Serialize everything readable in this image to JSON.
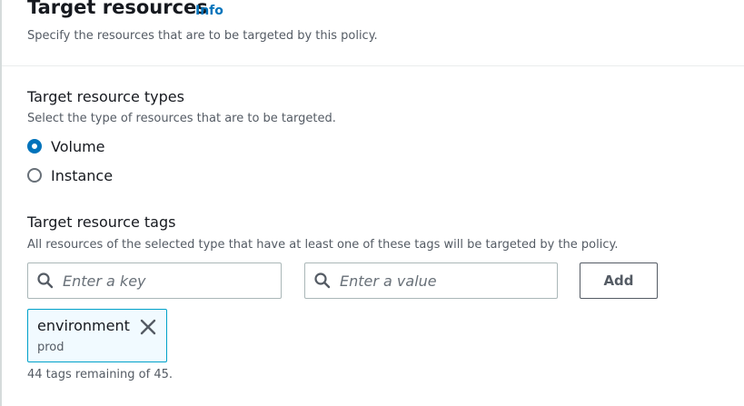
{
  "header": {
    "title": "Target resources",
    "info_link": "Info",
    "description": "Specify the resources that are to be targeted by this policy."
  },
  "resource_types": {
    "title": "Target resource types",
    "description": "Select the type of resources that are to be targeted.",
    "options": [
      {
        "label": "Volume",
        "selected": true
      },
      {
        "label": "Instance",
        "selected": false
      }
    ]
  },
  "resource_tags": {
    "title": "Target resource tags",
    "description": "All resources of the selected type that have at least one of these tags will be targeted by the policy.",
    "key_input": {
      "value": "",
      "placeholder": "Enter a key"
    },
    "value_input": {
      "value": "",
      "placeholder": "Enter a value"
    },
    "add_button": "Add",
    "tokens": [
      {
        "key": "environment",
        "value": "prod"
      }
    ],
    "remaining_text": "44 tags remaining of 45."
  },
  "colors": {
    "accent": "#0073bb",
    "token_border": "#00a1c9",
    "token_background": "#f1faff"
  },
  "icons": {
    "search": "search-icon",
    "dismiss": "close-icon"
  }
}
